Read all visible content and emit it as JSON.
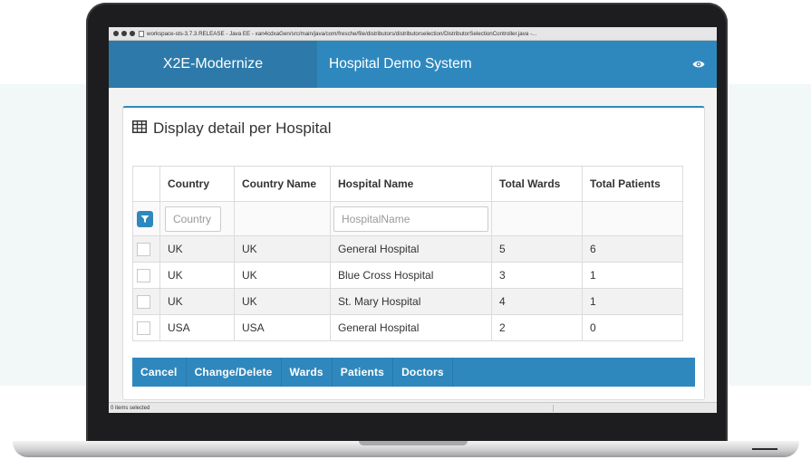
{
  "window": {
    "title": "workspace-sts-3.7.3.RELEASE - Java EE - xan4cdxaGen/src/main/java/com/fresche/file/distributors/distributorselection/DistributorSelectionController.java -..."
  },
  "navbar": {
    "brand": "X2E-Modernize",
    "app_title": "Hospital Demo System",
    "icon": "eye-icon"
  },
  "panel": {
    "title": "Display detail per Hospital",
    "icon": "table-grid-icon"
  },
  "table": {
    "columns": [
      "Country",
      "Country Name",
      "Hospital Name",
      "Total Wards",
      "Total Patients"
    ],
    "filters": {
      "country_placeholder": "Country",
      "hospital_placeholder": "HospitalName"
    },
    "rows": [
      [
        "UK",
        "UK",
        "General Hospital",
        "5",
        "6"
      ],
      [
        "UK",
        "UK",
        "Blue Cross Hospital",
        "3",
        "1"
      ],
      [
        "UK",
        "UK",
        "St. Mary Hospital",
        "4",
        "1"
      ],
      [
        "USA",
        "USA",
        "General Hospital",
        "2",
        "0"
      ]
    ]
  },
  "actions": [
    "Cancel",
    "Change/Delete",
    "Wards",
    "Patients",
    "Doctors"
  ],
  "status": {
    "text": "0 items selected"
  },
  "colors": {
    "accent": "#2f88bd",
    "brand_bg": "#2d7aaa"
  }
}
